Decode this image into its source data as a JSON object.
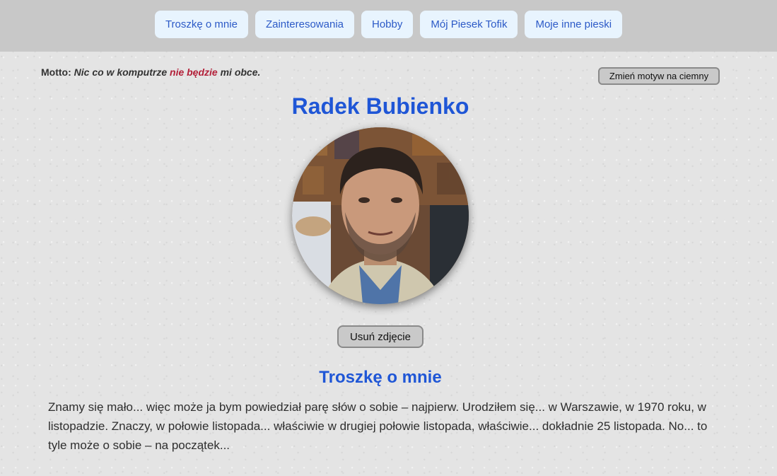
{
  "nav": {
    "items": [
      {
        "label": "Troszkę o mnie"
      },
      {
        "label": "Zainteresowania"
      },
      {
        "label": "Hobby"
      },
      {
        "label": "Mój Piesek Tofik"
      },
      {
        "label": "Moje inne pieski"
      }
    ]
  },
  "motto": {
    "label": "Motto:",
    "text_before": "Nic co w komputrze",
    "highlight": "nie będzie",
    "text_after": "mi obce."
  },
  "theme_button": {
    "label": "Zmień motyw na ciemny"
  },
  "profile": {
    "name": "Radek Bubienko",
    "photo_icon": "profile-photo"
  },
  "remove_photo_button": {
    "label": "Usuń zdjęcie"
  },
  "about": {
    "title": "Troszkę o mnie",
    "text": "Znamy się mało... więc może ja bym powiedział parę słów o sobie – najpierw. Urodziłem się... w Warszawie, w 1970 roku, w listopadzie. Znaczy, w połowie listopada... właściwie w drugiej połowie listopada, właściwie... dokładnie 25 listopada. No... to tyle może o sobie – na początek..."
  },
  "colors": {
    "topbar": "#c8c8c8",
    "nav_button_bg": "#e8f4fe",
    "nav_button_text": "#2c5ac7",
    "heading": "#1f56d6",
    "motto_accent": "#b3213a"
  }
}
